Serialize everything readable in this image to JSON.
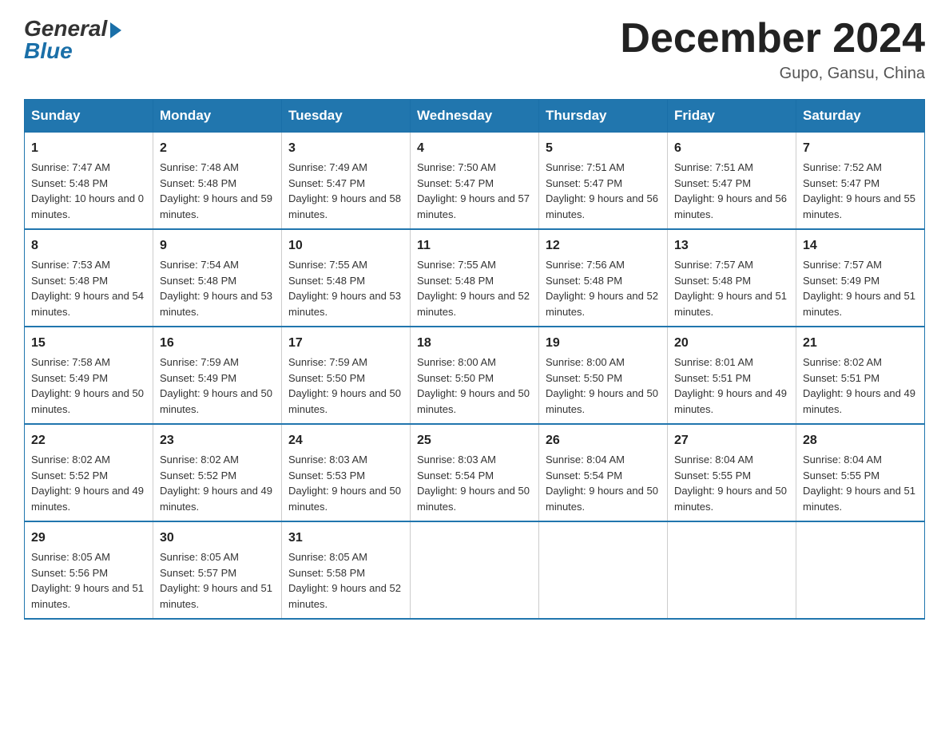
{
  "header": {
    "logo_general": "General",
    "logo_blue": "Blue",
    "month_title": "December 2024",
    "location": "Gupo, Gansu, China"
  },
  "days_of_week": [
    "Sunday",
    "Monday",
    "Tuesday",
    "Wednesday",
    "Thursday",
    "Friday",
    "Saturday"
  ],
  "weeks": [
    [
      {
        "day": "1",
        "sunrise": "Sunrise: 7:47 AM",
        "sunset": "Sunset: 5:48 PM",
        "daylight": "Daylight: 10 hours and 0 minutes."
      },
      {
        "day": "2",
        "sunrise": "Sunrise: 7:48 AM",
        "sunset": "Sunset: 5:48 PM",
        "daylight": "Daylight: 9 hours and 59 minutes."
      },
      {
        "day": "3",
        "sunrise": "Sunrise: 7:49 AM",
        "sunset": "Sunset: 5:47 PM",
        "daylight": "Daylight: 9 hours and 58 minutes."
      },
      {
        "day": "4",
        "sunrise": "Sunrise: 7:50 AM",
        "sunset": "Sunset: 5:47 PM",
        "daylight": "Daylight: 9 hours and 57 minutes."
      },
      {
        "day": "5",
        "sunrise": "Sunrise: 7:51 AM",
        "sunset": "Sunset: 5:47 PM",
        "daylight": "Daylight: 9 hours and 56 minutes."
      },
      {
        "day": "6",
        "sunrise": "Sunrise: 7:51 AM",
        "sunset": "Sunset: 5:47 PM",
        "daylight": "Daylight: 9 hours and 56 minutes."
      },
      {
        "day": "7",
        "sunrise": "Sunrise: 7:52 AM",
        "sunset": "Sunset: 5:47 PM",
        "daylight": "Daylight: 9 hours and 55 minutes."
      }
    ],
    [
      {
        "day": "8",
        "sunrise": "Sunrise: 7:53 AM",
        "sunset": "Sunset: 5:48 PM",
        "daylight": "Daylight: 9 hours and 54 minutes."
      },
      {
        "day": "9",
        "sunrise": "Sunrise: 7:54 AM",
        "sunset": "Sunset: 5:48 PM",
        "daylight": "Daylight: 9 hours and 53 minutes."
      },
      {
        "day": "10",
        "sunrise": "Sunrise: 7:55 AM",
        "sunset": "Sunset: 5:48 PM",
        "daylight": "Daylight: 9 hours and 53 minutes."
      },
      {
        "day": "11",
        "sunrise": "Sunrise: 7:55 AM",
        "sunset": "Sunset: 5:48 PM",
        "daylight": "Daylight: 9 hours and 52 minutes."
      },
      {
        "day": "12",
        "sunrise": "Sunrise: 7:56 AM",
        "sunset": "Sunset: 5:48 PM",
        "daylight": "Daylight: 9 hours and 52 minutes."
      },
      {
        "day": "13",
        "sunrise": "Sunrise: 7:57 AM",
        "sunset": "Sunset: 5:48 PM",
        "daylight": "Daylight: 9 hours and 51 minutes."
      },
      {
        "day": "14",
        "sunrise": "Sunrise: 7:57 AM",
        "sunset": "Sunset: 5:49 PM",
        "daylight": "Daylight: 9 hours and 51 minutes."
      }
    ],
    [
      {
        "day": "15",
        "sunrise": "Sunrise: 7:58 AM",
        "sunset": "Sunset: 5:49 PM",
        "daylight": "Daylight: 9 hours and 50 minutes."
      },
      {
        "day": "16",
        "sunrise": "Sunrise: 7:59 AM",
        "sunset": "Sunset: 5:49 PM",
        "daylight": "Daylight: 9 hours and 50 minutes."
      },
      {
        "day": "17",
        "sunrise": "Sunrise: 7:59 AM",
        "sunset": "Sunset: 5:50 PM",
        "daylight": "Daylight: 9 hours and 50 minutes."
      },
      {
        "day": "18",
        "sunrise": "Sunrise: 8:00 AM",
        "sunset": "Sunset: 5:50 PM",
        "daylight": "Daylight: 9 hours and 50 minutes."
      },
      {
        "day": "19",
        "sunrise": "Sunrise: 8:00 AM",
        "sunset": "Sunset: 5:50 PM",
        "daylight": "Daylight: 9 hours and 50 minutes."
      },
      {
        "day": "20",
        "sunrise": "Sunrise: 8:01 AM",
        "sunset": "Sunset: 5:51 PM",
        "daylight": "Daylight: 9 hours and 49 minutes."
      },
      {
        "day": "21",
        "sunrise": "Sunrise: 8:02 AM",
        "sunset": "Sunset: 5:51 PM",
        "daylight": "Daylight: 9 hours and 49 minutes."
      }
    ],
    [
      {
        "day": "22",
        "sunrise": "Sunrise: 8:02 AM",
        "sunset": "Sunset: 5:52 PM",
        "daylight": "Daylight: 9 hours and 49 minutes."
      },
      {
        "day": "23",
        "sunrise": "Sunrise: 8:02 AM",
        "sunset": "Sunset: 5:52 PM",
        "daylight": "Daylight: 9 hours and 49 minutes."
      },
      {
        "day": "24",
        "sunrise": "Sunrise: 8:03 AM",
        "sunset": "Sunset: 5:53 PM",
        "daylight": "Daylight: 9 hours and 50 minutes."
      },
      {
        "day": "25",
        "sunrise": "Sunrise: 8:03 AM",
        "sunset": "Sunset: 5:54 PM",
        "daylight": "Daylight: 9 hours and 50 minutes."
      },
      {
        "day": "26",
        "sunrise": "Sunrise: 8:04 AM",
        "sunset": "Sunset: 5:54 PM",
        "daylight": "Daylight: 9 hours and 50 minutes."
      },
      {
        "day": "27",
        "sunrise": "Sunrise: 8:04 AM",
        "sunset": "Sunset: 5:55 PM",
        "daylight": "Daylight: 9 hours and 50 minutes."
      },
      {
        "day": "28",
        "sunrise": "Sunrise: 8:04 AM",
        "sunset": "Sunset: 5:55 PM",
        "daylight": "Daylight: 9 hours and 51 minutes."
      }
    ],
    [
      {
        "day": "29",
        "sunrise": "Sunrise: 8:05 AM",
        "sunset": "Sunset: 5:56 PM",
        "daylight": "Daylight: 9 hours and 51 minutes."
      },
      {
        "day": "30",
        "sunrise": "Sunrise: 8:05 AM",
        "sunset": "Sunset: 5:57 PM",
        "daylight": "Daylight: 9 hours and 51 minutes."
      },
      {
        "day": "31",
        "sunrise": "Sunrise: 8:05 AM",
        "sunset": "Sunset: 5:58 PM",
        "daylight": "Daylight: 9 hours and 52 minutes."
      },
      null,
      null,
      null,
      null
    ]
  ]
}
